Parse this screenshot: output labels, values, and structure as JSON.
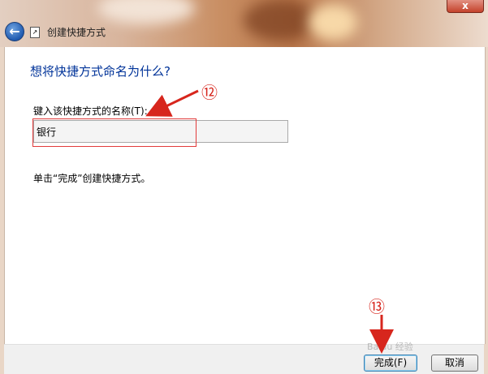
{
  "window": {
    "title": "创建快捷方式",
    "close_glyph": "x"
  },
  "content": {
    "heading": "想将快捷方式命名为什么?",
    "input_label": "键入该快捷方式的名称(T):",
    "input_value": "银行",
    "instruction": "单击“完成”创建快捷方式。"
  },
  "buttons": {
    "finish": "完成(F)",
    "cancel": "取消"
  },
  "annotations": {
    "step12": "⑫",
    "step13": "⑬",
    "watermark": "Baidu 经验"
  },
  "colors": {
    "heading": "#003399",
    "annotation": "#d7261d"
  }
}
